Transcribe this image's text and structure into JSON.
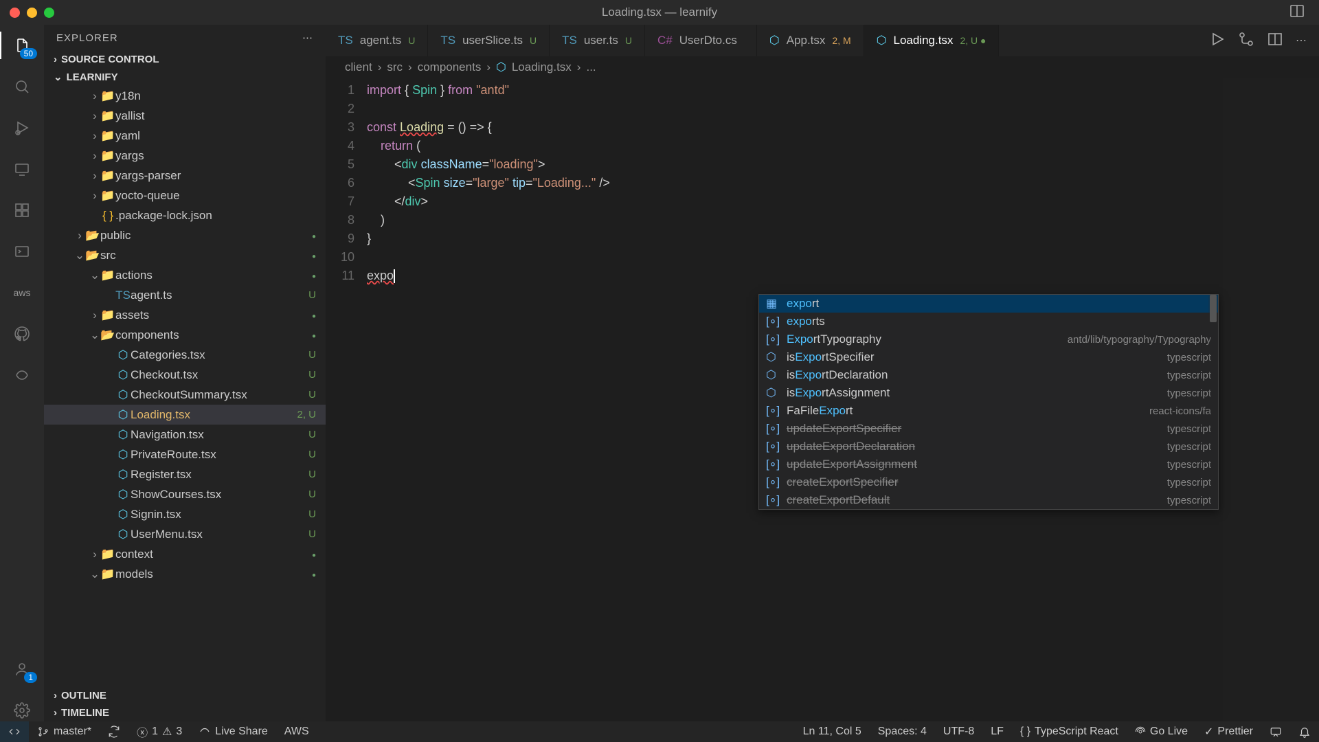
{
  "title": "Loading.tsx — learnify",
  "explorer": {
    "label": "EXPLORER"
  },
  "sections": {
    "source_control": "SOURCE CONTROL",
    "project": "LEARNIFY",
    "outline": "OUTLINE",
    "timeline": "TIMELINE"
  },
  "activity_badge": "50",
  "account_badge": "1",
  "tree": [
    {
      "name": "y18n",
      "type": "folder",
      "indent": 3
    },
    {
      "name": "yallist",
      "type": "folder",
      "indent": 3
    },
    {
      "name": "yaml",
      "type": "folder",
      "indent": 3
    },
    {
      "name": "yargs",
      "type": "folder",
      "indent": 3
    },
    {
      "name": "yargs-parser",
      "type": "folder",
      "indent": 3
    },
    {
      "name": "yocto-queue",
      "type": "folder",
      "indent": 3
    },
    {
      "name": ".package-lock.json",
      "type": "json",
      "indent": 3
    },
    {
      "name": "public",
      "type": "folder-open",
      "indent": 2,
      "status": "dot"
    },
    {
      "name": "src",
      "type": "folder-src",
      "indent": 2,
      "open": true,
      "status": "dot"
    },
    {
      "name": "actions",
      "type": "folder",
      "indent": 3,
      "open": true,
      "status": "dot"
    },
    {
      "name": "agent.ts",
      "type": "ts",
      "indent": 4,
      "status": "U"
    },
    {
      "name": "assets",
      "type": "folder-assets",
      "indent": 3,
      "status": "dot"
    },
    {
      "name": "components",
      "type": "folder-react",
      "indent": 3,
      "open": true,
      "status": "dot"
    },
    {
      "name": "Categories.tsx",
      "type": "react",
      "indent": 4,
      "status": "U"
    },
    {
      "name": "Checkout.tsx",
      "type": "react",
      "indent": 4,
      "status": "U"
    },
    {
      "name": "CheckoutSummary.tsx",
      "type": "react",
      "indent": 4,
      "status": "U"
    },
    {
      "name": "Loading.tsx",
      "type": "react",
      "indent": 4,
      "status": "2, U",
      "selected": true
    },
    {
      "name": "Navigation.tsx",
      "type": "react",
      "indent": 4,
      "status": "U"
    },
    {
      "name": "PrivateRoute.tsx",
      "type": "react",
      "indent": 4,
      "status": "U"
    },
    {
      "name": "Register.tsx",
      "type": "react",
      "indent": 4,
      "status": "U"
    },
    {
      "name": "ShowCourses.tsx",
      "type": "react",
      "indent": 4,
      "status": "U"
    },
    {
      "name": "Signin.tsx",
      "type": "react",
      "indent": 4,
      "status": "U"
    },
    {
      "name": "UserMenu.tsx",
      "type": "react",
      "indent": 4,
      "status": "U"
    },
    {
      "name": "context",
      "type": "folder",
      "indent": 3,
      "status": "dot"
    },
    {
      "name": "models",
      "type": "folder",
      "indent": 3,
      "open": true,
      "status": "dot"
    }
  ],
  "tabs": [
    {
      "label": "agent.ts",
      "icon": "ts",
      "mod": "U",
      "modColor": "#6a9955"
    },
    {
      "label": "userSlice.ts",
      "icon": "ts",
      "mod": "U",
      "modColor": "#6a9955"
    },
    {
      "label": "user.ts",
      "icon": "ts",
      "mod": "U",
      "modColor": "#6a9955"
    },
    {
      "label": "UserDto.cs",
      "icon": "cs",
      "mod": "",
      "modColor": ""
    },
    {
      "label": "App.tsx",
      "icon": "react",
      "mod": "2, M",
      "modColor": "#d9a35a"
    },
    {
      "label": "Loading.tsx",
      "icon": "react",
      "mod": "2, U",
      "modColor": "#6a9955",
      "active": true,
      "dirty": true
    }
  ],
  "breadcrumbs": [
    "client",
    "src",
    "components",
    "Loading.tsx",
    "..."
  ],
  "code": {
    "lines": [
      "1",
      "2",
      "3",
      "4",
      "5",
      "6",
      "7",
      "8",
      "9",
      "10",
      "11"
    ],
    "typed": "expo"
  },
  "suggestions": [
    {
      "label": "export",
      "prefix": "expo",
      "rest": "rt",
      "hint": "",
      "kind": "snip",
      "sel": true
    },
    {
      "label": "exports",
      "prefix": "expo",
      "rest": "rts",
      "hint": "",
      "kind": "var"
    },
    {
      "label": "ExportTypography",
      "prefix": "Expo",
      "rest": "rtTypography",
      "hint": "antd/lib/typography/Typography",
      "kind": "var"
    },
    {
      "label": "isExportSpecifier",
      "prefix": "isExpo",
      "rest": "rtSpecifier",
      "hint": "typescript",
      "kind": "func"
    },
    {
      "label": "isExportDeclaration",
      "prefix": "isExpo",
      "rest": "rtDeclaration",
      "hint": "typescript",
      "kind": "func"
    },
    {
      "label": "isExportAssignment",
      "prefix": "isExpo",
      "rest": "rtAssignment",
      "hint": "typescript",
      "kind": "func"
    },
    {
      "label": "FaFileExport",
      "prefix": "FaFileExpo",
      "rest": "rt",
      "hint": "react-icons/fa",
      "kind": "var"
    },
    {
      "label": "updateExportSpecifier",
      "hint": "typescript",
      "kind": "var",
      "dep": true
    },
    {
      "label": "updateExportDeclaration",
      "hint": "typescript",
      "kind": "var",
      "dep": true
    },
    {
      "label": "updateExportAssignment",
      "hint": "typescript",
      "kind": "var",
      "dep": true
    },
    {
      "label": "createExportSpecifier",
      "hint": "typescript",
      "kind": "var",
      "dep": true
    },
    {
      "label": "createExportDefault",
      "hint": "typescript",
      "kind": "var",
      "dep": true
    }
  ],
  "status": {
    "branch": "master*",
    "errors": "1",
    "warnings": "3",
    "live_share": "Live Share",
    "aws": "AWS",
    "cursor": "Ln 11, Col 5",
    "spaces": "Spaces: 4",
    "encoding": "UTF-8",
    "eol": "LF",
    "lang": "TypeScript React",
    "golive": "Go Live",
    "prettier": "Prettier"
  }
}
